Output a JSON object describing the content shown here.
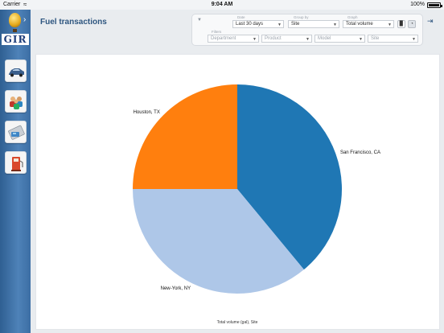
{
  "status_bar": {
    "carrier": "Carrier",
    "time": "9:04 AM",
    "battery": "100%"
  },
  "app": {
    "logo_text": "GIR"
  },
  "sidebar": {
    "items": [
      {
        "icon": "vehicle-icon"
      },
      {
        "icon": "users-icon"
      },
      {
        "icon": "fuel-card-icon"
      },
      {
        "icon": "fuel-pump-icon"
      }
    ]
  },
  "page": {
    "title": "Fuel transactions"
  },
  "filters": {
    "date": {
      "label": "Date",
      "value": "Last 30 days"
    },
    "group_by": {
      "label": "Group by",
      "value": "Site"
    },
    "graph": {
      "label": "Graph",
      "value": "Total volume"
    },
    "filters_label": "Filters",
    "department": {
      "placeholder": "Department"
    },
    "product": {
      "placeholder": "Product"
    },
    "model": {
      "placeholder": "Model"
    },
    "site": {
      "placeholder": "Site"
    }
  },
  "chart_data": {
    "type": "pie",
    "caption": "Total volume (gal), Site",
    "slices": [
      {
        "label": "San Francisco, CA",
        "value": 39,
        "color": "#1f77b4"
      },
      {
        "label": "New-York, NY",
        "value": 36,
        "color": "#aec7e8"
      },
      {
        "label": "Houston, TX",
        "value": 25,
        "color": "#ff7f0e"
      }
    ]
  }
}
